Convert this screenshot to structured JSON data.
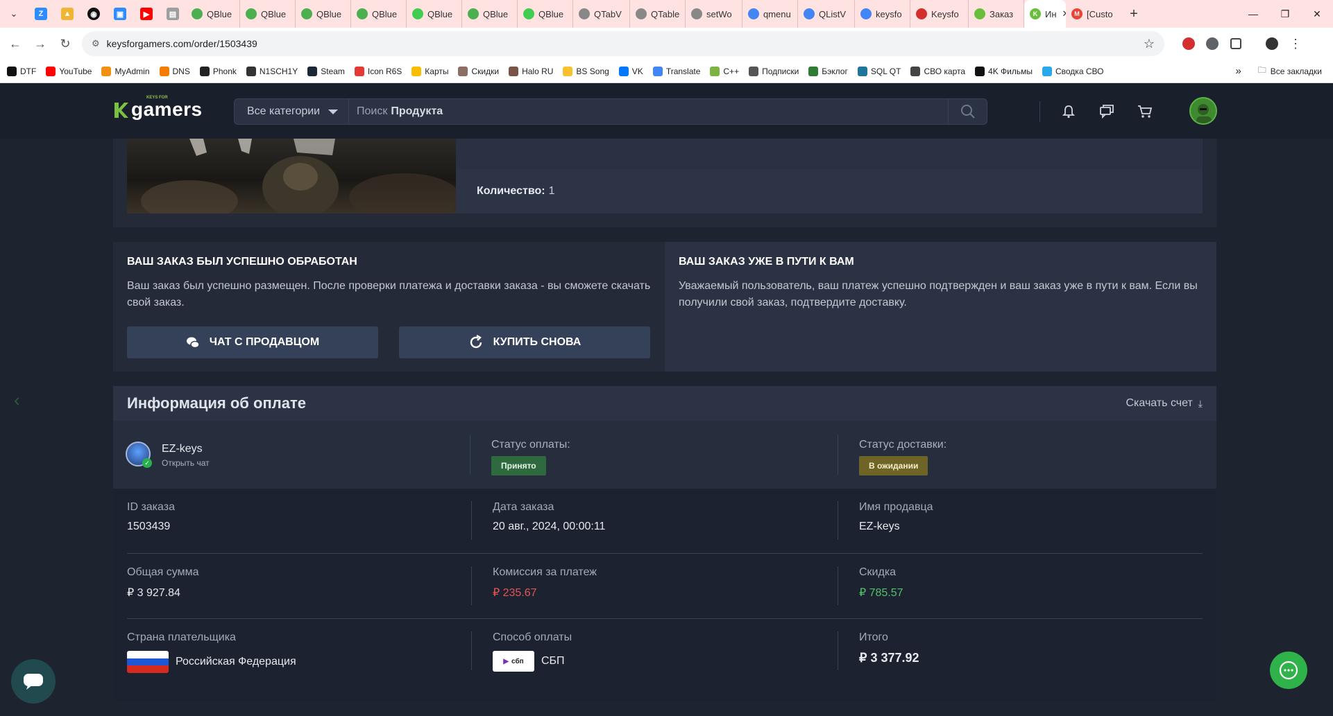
{
  "browser": {
    "tabs": [
      {
        "label": "QBlue",
        "color": "#4caf50"
      },
      {
        "label": "QBlue",
        "color": "#4caf50"
      },
      {
        "label": "QBlue",
        "color": "#4caf50"
      },
      {
        "label": "QBlue",
        "color": "#4caf50"
      },
      {
        "label": "QBlue",
        "color": "#41cd52"
      },
      {
        "label": "QBlue",
        "color": "#4caf50"
      },
      {
        "label": "QBlue",
        "color": "#41cd52"
      },
      {
        "label": "QTabV",
        "color": "#888888"
      },
      {
        "label": "QTable",
        "color": "#888888"
      },
      {
        "label": "setWo",
        "color": "#888888"
      },
      {
        "label": "qmenu",
        "color": "#4285f4"
      },
      {
        "label": "QListV",
        "color": "#4285f4"
      },
      {
        "label": "keysfo",
        "color": "#4285f4"
      },
      {
        "label": "Keysfo",
        "color": "#d32f2f"
      },
      {
        "label": "Заказ",
        "color": "#6abf3a"
      }
    ],
    "active_tab": {
      "label": "Ин",
      "color": "#6abf3a"
    },
    "last_tab": {
      "label": "[Custo",
      "color": "#ea4335"
    },
    "url": "keysforgamers.com/order/1503439",
    "bookmarks": [
      {
        "label": "DTF",
        "color": "#111111"
      },
      {
        "label": "YouTube",
        "color": "#ff0000"
      },
      {
        "label": "MyAdmin",
        "color": "#f29111"
      },
      {
        "label": "DNS",
        "color": "#f57c00"
      },
      {
        "label": "Phonk",
        "color": "#222222"
      },
      {
        "label": "N1SCH1Y",
        "color": "#333333"
      },
      {
        "label": "Steam",
        "color": "#1b2838"
      },
      {
        "label": "Icon R6S",
        "color": "#e53935"
      },
      {
        "label": "Карты",
        "color": "#fbbc04"
      },
      {
        "label": "Скидки",
        "color": "#8d6e63"
      },
      {
        "label": "Halo RU",
        "color": "#795548"
      },
      {
        "label": "BS Song",
        "color": "#fbc02d"
      },
      {
        "label": "VK",
        "color": "#0077ff"
      },
      {
        "label": "Translate",
        "color": "#4285f4"
      },
      {
        "label": "C++",
        "color": "#7cb342"
      },
      {
        "label": "Подписки",
        "color": "#555555"
      },
      {
        "label": "Бэклог",
        "color": "#2e7d32"
      },
      {
        "label": "SQL QT",
        "color": "#21759b"
      },
      {
        "label": "СВО карта",
        "color": "#444444"
      },
      {
        "label": "4K Фильмы",
        "color": "#111111"
      },
      {
        "label": "Сводка СВО",
        "color": "#29a9eb"
      }
    ],
    "all_bookmarks": "Все закладки"
  },
  "header": {
    "logo_small": "KEYS FOR",
    "logo": "gamers",
    "category_select": "Все категории",
    "search_prefix": "Поиск",
    "search_bold": "Продукта"
  },
  "product": {
    "qty_label": "Количество:",
    "qty_value": "1"
  },
  "status_left": {
    "title": "ВАШ ЗАКАЗ БЫЛ УСПЕШНО ОБРАБОТАН",
    "text": "Ваш заказ был успешно размещен. После проверки платежа и доставки заказа - вы сможете скачать свой заказ.",
    "chat_button": "ЧАТ С ПРОДАВЦОМ",
    "buy_again_button": "КУПИТЬ СНОВА"
  },
  "status_right": {
    "title": "ВАШ ЗАКАЗ УЖЕ В ПУТИ К ВАМ",
    "text": "Уважаемый пользователь, ваш платеж успешно подтвержден и ваш заказ уже в пути к вам. Если вы получили свой заказ, подтвердите доставку."
  },
  "payment": {
    "title": "Информация об оплате",
    "download": "Скачать счет",
    "seller_name": "EZ-keys",
    "seller_sub": "Открыть чат",
    "payment_status_label": "Статус оплаты:",
    "payment_status": "Принято",
    "delivery_status_label": "Статус доставки:",
    "delivery_status": "В ожидании",
    "order_id_label": "ID заказа",
    "order_id": "1503439",
    "order_date_label": "Дата заказа",
    "order_date": "20 авг., 2024, 00:00:11",
    "seller_label": "Имя продавца",
    "seller_value": "EZ-keys",
    "total_label": "Общая сумма",
    "total": "₽ 3 927.84",
    "fee_label": "Комиссия за платеж",
    "fee": "₽ 235.67",
    "discount_label": "Скидка",
    "discount": "₽ 785.57",
    "country_label": "Страна плательщика",
    "country": "Российская Федерация",
    "method_label": "Способ оплаты",
    "method_logo": "сбп",
    "method": "СБП",
    "result_label": "Итого",
    "result": "₽ 3 377.92"
  }
}
